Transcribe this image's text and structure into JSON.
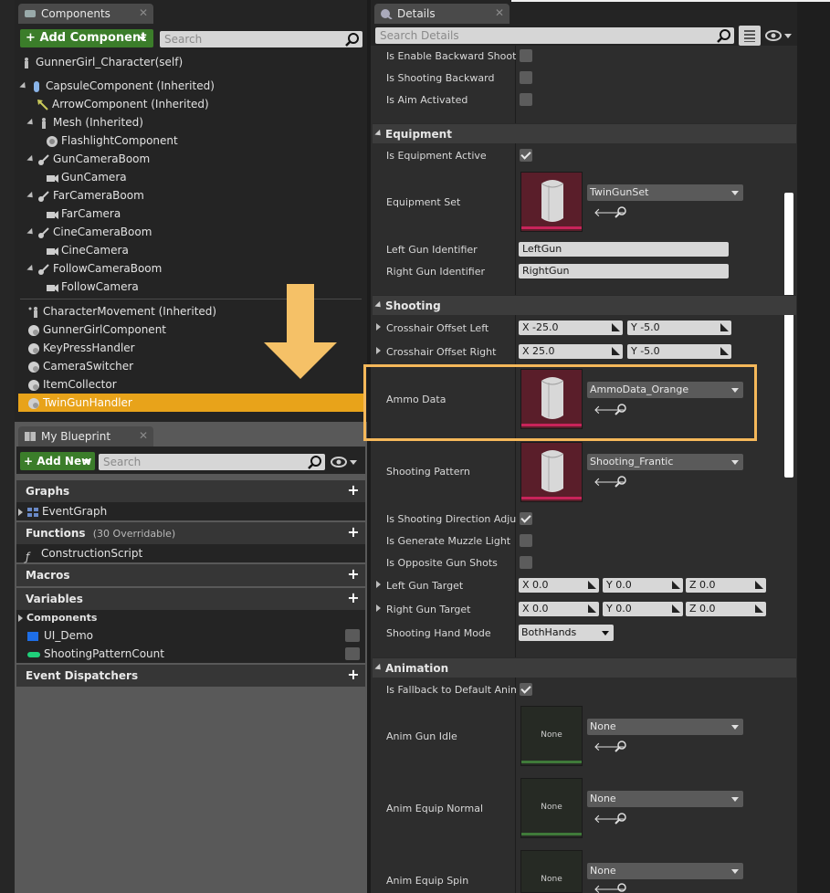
{
  "components_panel": {
    "tab_title": "Components",
    "add_button": "Add Component",
    "search_placeholder": "Search",
    "self_row": "GunnerGirl_Character(self)",
    "tree": [
      {
        "label": "CapsuleComponent (Inherited)",
        "icon": "capsule-icon"
      },
      {
        "label": "ArrowComponent (Inherited)",
        "icon": "arrow-icon"
      },
      {
        "label": "Mesh (Inherited)",
        "icon": "mesh-icon"
      },
      {
        "label": "FlashlightComponent",
        "icon": "component-icon"
      },
      {
        "label": "GunCameraBoom",
        "icon": "spring-arm-icon"
      },
      {
        "label": "GunCamera",
        "icon": "camera-icon"
      },
      {
        "label": "FarCameraBoom",
        "icon": "spring-arm-icon"
      },
      {
        "label": "FarCamera",
        "icon": "camera-icon"
      },
      {
        "label": "CineCameraBoom",
        "icon": "spring-arm-icon"
      },
      {
        "label": "CineCamera",
        "icon": "camera-icon"
      },
      {
        "label": "FollowCameraBoom",
        "icon": "spring-arm-icon"
      },
      {
        "label": "FollowCamera",
        "icon": "camera-icon"
      }
    ],
    "actor_components": [
      "CharacterMovement (Inherited)",
      "GunnerGirlComponent",
      "KeyPressHandler",
      "CameraSwitcher",
      "ItemCollector",
      "TwinGunHandler"
    ],
    "selected_item": "TwinGunHandler"
  },
  "blueprint_panel": {
    "tab_title": "My Blueprint",
    "add_button": "Add New",
    "search_placeholder": "Search",
    "graphs_header": "Graphs",
    "graph_item": "EventGraph",
    "functions_header": "Functions",
    "functions_note": "(30 Overridable)",
    "function_item": "ConstructionScript",
    "macros_header": "Macros",
    "variables_header": "Variables",
    "components_subheader": "Components",
    "variables": [
      {
        "label": "UI_Demo",
        "color": "#1e6ee6"
      },
      {
        "label": "ShootingPatternCount",
        "color": "#1fd07a"
      }
    ],
    "dispatchers_header": "Event Dispatchers"
  },
  "details_panel": {
    "tab_title": "Details",
    "search_placeholder": "Search Details",
    "top_props": [
      {
        "label": "Is Enable Backward Shooting",
        "checked": false
      },
      {
        "label": "Is Shooting Backward",
        "checked": false
      },
      {
        "label": "Is Aim Activated",
        "checked": false
      }
    ],
    "equipment": {
      "header": "Equipment",
      "is_active_label": "Is Equipment Active",
      "is_active": true,
      "set_label": "Equipment Set",
      "set_value": "TwinGunSet",
      "left_id_label": "Left Gun Identifier",
      "left_id_value": "LeftGun",
      "right_id_label": "Right Gun Identifier",
      "right_id_value": "RightGun"
    },
    "shooting": {
      "header": "Shooting",
      "crosshair_left_label": "Crosshair Offset Left",
      "crosshair_left": {
        "x": "X  -25.0",
        "y": "Y  -5.0"
      },
      "crosshair_right_label": "Crosshair Offset Right",
      "crosshair_right": {
        "x": "X  25.0",
        "y": "Y  -5.0"
      },
      "ammo_label": "Ammo Data",
      "ammo_value": "AmmoData_Orange",
      "pattern_label": "Shooting Pattern",
      "pattern_value": "Shooting_Frantic",
      "dir_adjust_label": "Is Shooting Direction Adjusted",
      "dir_adjust": true,
      "muzzle_label": "Is Generate Muzzle Light",
      "muzzle": false,
      "opposite_label": "Is Opposite Gun Shots",
      "opposite": false,
      "left_target_label": "Left Gun Target",
      "left_target": {
        "x": "X  0.0",
        "y": "Y  0.0",
        "z": "Z  0.0"
      },
      "right_target_label": "Right Gun Target",
      "right_target": {
        "x": "X  0.0",
        "y": "Y  0.0",
        "z": "Z  0.0"
      },
      "hand_mode_label": "Shooting Hand Mode",
      "hand_mode_value": "BothHands"
    },
    "animation": {
      "header": "Animation",
      "fallback_label": "Is Fallback to Default Animation",
      "fallback": true,
      "gun_idle_label": "Anim Gun Idle",
      "gun_idle_value": "None",
      "equip_normal_label": "Anim Equip Normal",
      "equip_normal_value": "None",
      "equip_spin_label": "Anim Equip Spin",
      "equip_spin_value": "None",
      "thumb_none_text": "None"
    }
  },
  "highlight_color": "#f5b85a",
  "selection_color": "#e8a31a"
}
